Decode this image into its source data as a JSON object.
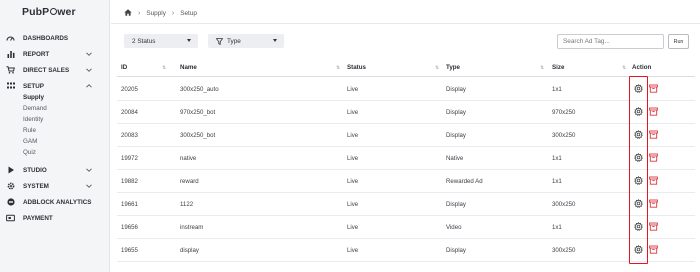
{
  "brand": {
    "logo_prefix": "PubP",
    "logo_suffix": "wer"
  },
  "sidebar": {
    "items": [
      {
        "label": "DASHBOARDS",
        "icon": "dashboard-icon",
        "has_chevron": false
      },
      {
        "label": "REPORT",
        "icon": "bar-chart-icon",
        "has_chevron": true
      },
      {
        "label": "DIRECT SALES",
        "icon": "cart-icon",
        "has_chevron": true
      },
      {
        "label": "SETUP",
        "icon": "grid-icon",
        "has_chevron": true,
        "expanded": true
      },
      {
        "label": "STUDIO",
        "icon": "play-icon",
        "has_chevron": true
      },
      {
        "label": "SYSTEM",
        "icon": "gear-icon",
        "has_chevron": true
      },
      {
        "label": "ADBLOCK ANALYTICS",
        "icon": "adblock-icon",
        "has_chevron": false
      },
      {
        "label": "PAYMENT",
        "icon": "payment-icon",
        "has_chevron": false
      }
    ],
    "setup_subitems": [
      "Supply",
      "Demand",
      "Identity",
      "Rule",
      "GAM",
      "Quiz"
    ],
    "active_subitem": "Supply"
  },
  "breadcrumb": {
    "home_icon": "home-icon",
    "items": [
      "Supply",
      "Setup"
    ]
  },
  "filters": {
    "status_label": "2 Status",
    "type_label": "Type",
    "search_placeholder": "Search Ad Tag...",
    "run_label": "Run"
  },
  "table": {
    "headers": {
      "id": "ID",
      "name": "Name",
      "status": "Status",
      "type": "Type",
      "size": "Size",
      "action": "Action"
    },
    "rows": [
      {
        "id": "20205",
        "name": "300x250_auto",
        "status": "Live",
        "type": "Display",
        "size": "1x1"
      },
      {
        "id": "20084",
        "name": "970x250_bot",
        "status": "Live",
        "type": "Display",
        "size": "970x250"
      },
      {
        "id": "20083",
        "name": "300x250_bot",
        "status": "Live",
        "type": "Display",
        "size": "300x250"
      },
      {
        "id": "19972",
        "name": "native",
        "status": "Live",
        "type": "Native",
        "size": "1x1"
      },
      {
        "id": "19882",
        "name": "reward",
        "status": "Live",
        "type": "Rewarded Ad",
        "size": "1x1"
      },
      {
        "id": "19661",
        "name": "1122",
        "status": "Live",
        "type": "Display",
        "size": "300x250"
      },
      {
        "id": "19656",
        "name": "instream",
        "status": "Live",
        "type": "Video",
        "size": "1x1"
      },
      {
        "id": "19655",
        "name": "display",
        "status": "Live",
        "type": "Display",
        "size": "300x250"
      }
    ],
    "row_action_icons": [
      "gear-icon",
      "archive-icon"
    ]
  },
  "colors": {
    "highlight": "#e0171f",
    "sidebar_bg": "#f4f5f7",
    "archive_icon": "#d9363e"
  }
}
